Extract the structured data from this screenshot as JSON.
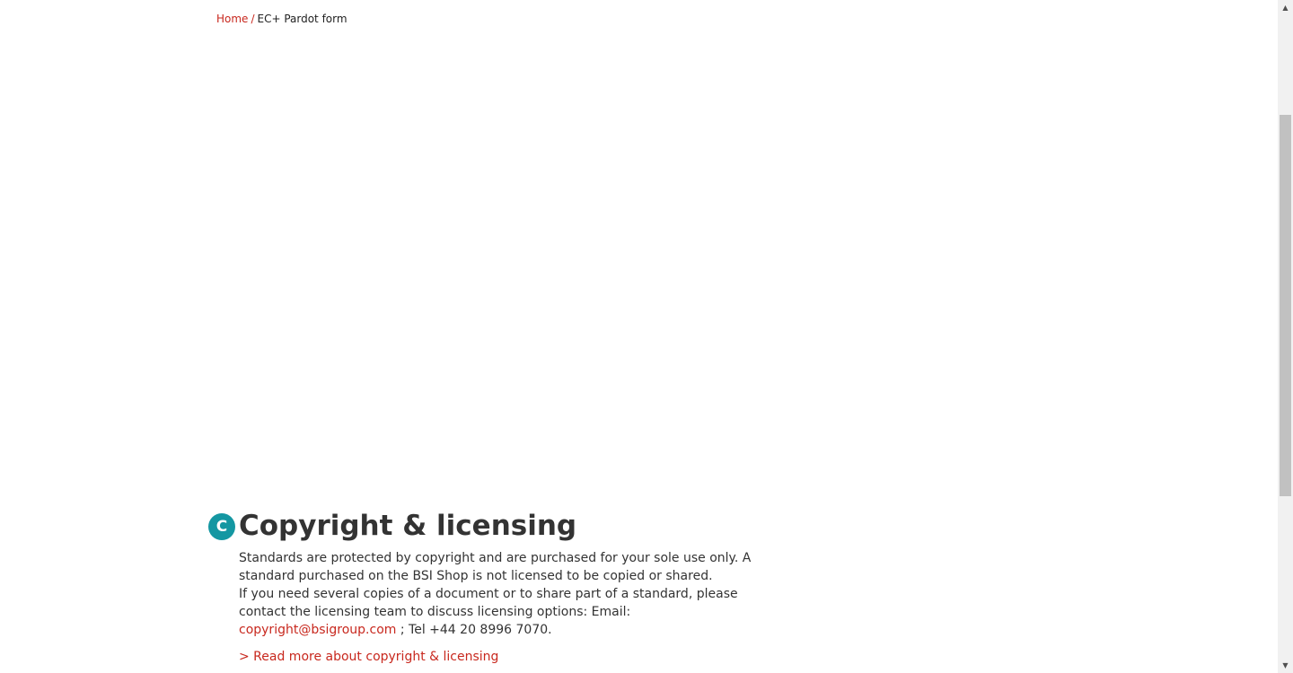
{
  "breadcrumb": {
    "home_label": "Home",
    "separator": "/",
    "current_label": "EC+ Pardot form"
  },
  "copyright_section": {
    "badge_letter": "C",
    "title": "Copyright & licensing",
    "paragraph_1": "Standards are protected by copyright and are purchased for your sole use only. A standard purchased on the BSI Shop is not licensed to be copied or shared.",
    "paragraph_2_before_email": "If you need several copies of a document or to share part of a standard, please contact the licensing team to discuss licensing options: Email: ",
    "email": "copyright@bsigroup.com",
    "paragraph_2_after_email": " ; Tel +44 20 8996 7070.",
    "read_more_label": "> Read more about copyright & licensing"
  },
  "scrollbar": {
    "up_icon": "▲",
    "down_icon": "▼"
  },
  "colors": {
    "link": "#c8281e",
    "badge": "#1497a2",
    "text": "#333333"
  }
}
